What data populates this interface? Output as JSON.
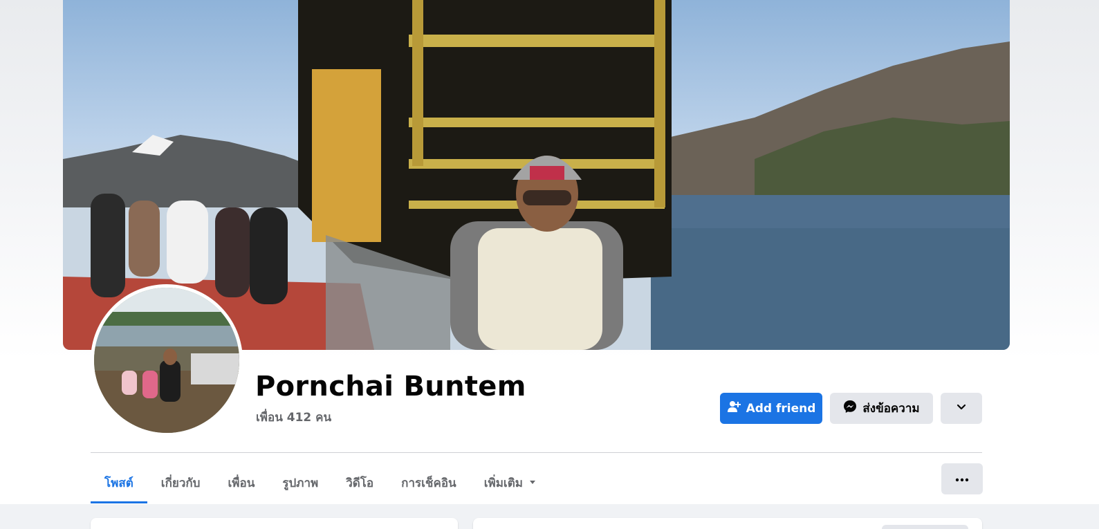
{
  "profile": {
    "name": "Pornchai Buntem",
    "friends_text": "เพื่อน 412 คน"
  },
  "actions": {
    "add_friend_label": "Add friend",
    "message_label": "ส่งข้อความ",
    "add_friend_icon": "person-add-icon",
    "message_icon": "messenger-icon",
    "more_icon": "chevron-down-icon"
  },
  "tabs": [
    {
      "label": "โพสต์",
      "active": true
    },
    {
      "label": "เกี่ยวกับ",
      "active": false
    },
    {
      "label": "เพื่อน",
      "active": false
    },
    {
      "label": "รูปภาพ",
      "active": false
    },
    {
      "label": "วิดีโอ",
      "active": false
    },
    {
      "label": "การเช็คอิน",
      "active": false
    },
    {
      "label": "เพิ่มเติม",
      "active": false
    }
  ],
  "colors": {
    "accent": "#1b74e4",
    "secondary_button": "#e4e6eb",
    "muted_text": "#65676b"
  }
}
